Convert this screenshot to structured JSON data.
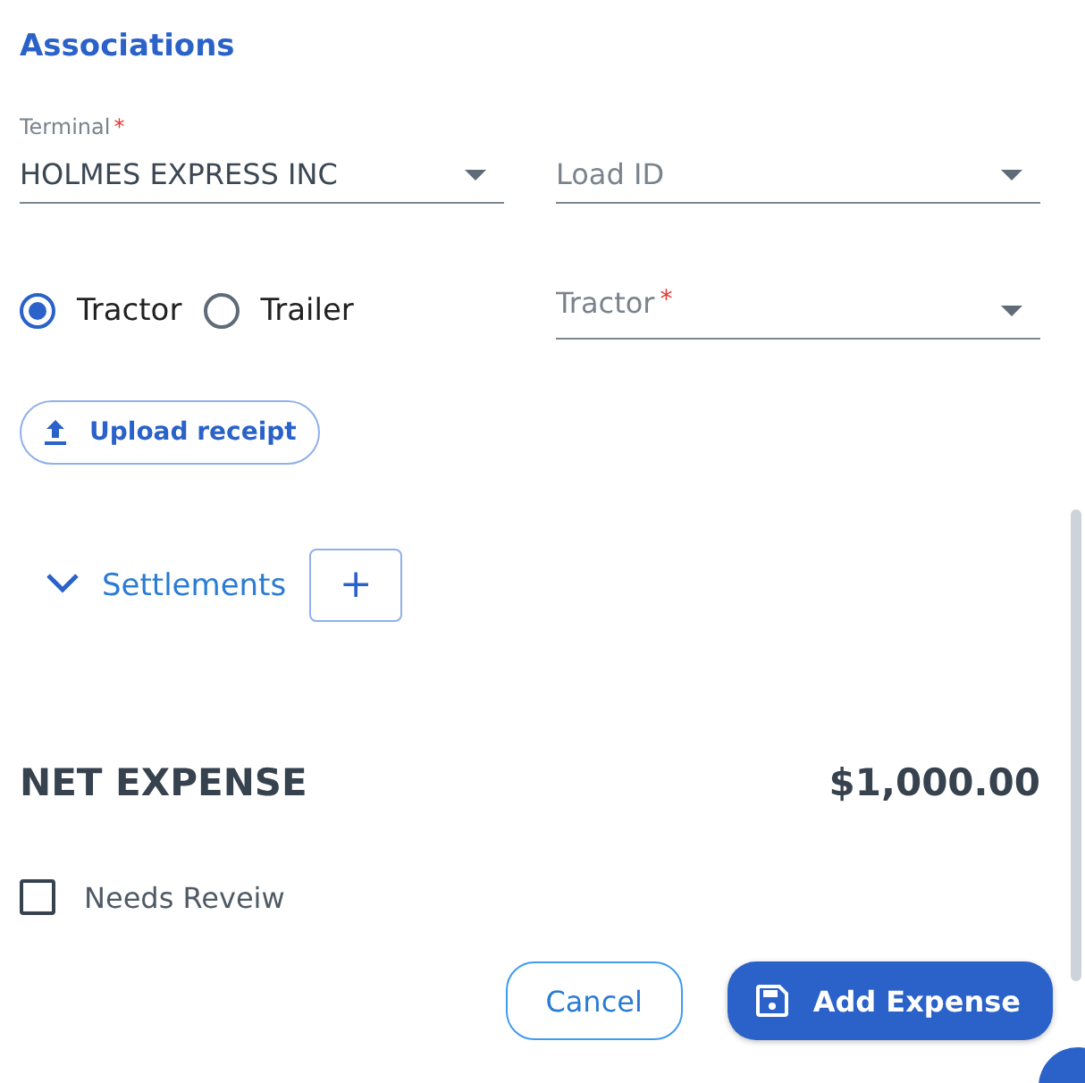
{
  "section_title": "Associations",
  "terminal": {
    "label": "Terminal",
    "required_mark": "*",
    "value": "HOLMES EXPRESS INC"
  },
  "load_id": {
    "placeholder": "Load ID"
  },
  "vehicle_type": [
    {
      "label": "Tractor",
      "selected": true
    },
    {
      "label": "Trailer",
      "selected": false
    }
  ],
  "tractor": {
    "label": "Tractor",
    "required_mark": "*"
  },
  "upload_button": "Upload receipt",
  "settlements": {
    "label": "Settlements",
    "expanded": true,
    "add_button": "+"
  },
  "net_expense": {
    "label": "NET EXPENSE",
    "amount": "$1,000.00"
  },
  "needs_review": {
    "label": "Needs Reveiw",
    "checked": false
  },
  "buttons": [
    {
      "label": "Cancel",
      "kind": "outline"
    },
    {
      "label": "Add Expense",
      "kind": "primary"
    }
  ]
}
